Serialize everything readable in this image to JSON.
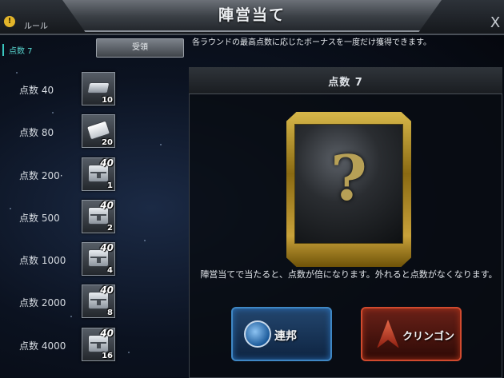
{
  "header": {
    "title": "陣営当て",
    "rule_label": "ルール",
    "rule_icon": "info-icon",
    "close_label": "X"
  },
  "status": {
    "current_score": "点数 7"
  },
  "tabs": {
    "receive_label": "受領"
  },
  "description_top": "各ラウンドの最高点数に応じたボーナスを一度だけ獲得できます。",
  "rewards": [
    {
      "label": "点数 40",
      "icon": "silver-bar-icon",
      "count": "10",
      "badge": ""
    },
    {
      "label": "点数 80",
      "icon": "document-icon",
      "count": "20",
      "badge": ""
    },
    {
      "label": "点数 200·",
      "icon": "chest-icon",
      "count": "1",
      "badge": "40"
    },
    {
      "label": "点数 500",
      "icon": "chest-icon",
      "count": "2",
      "badge": "40"
    },
    {
      "label": "点数 1000",
      "icon": "chest-icon",
      "count": "4",
      "badge": "40"
    },
    {
      "label": "点数 2000",
      "icon": "chest-icon",
      "count": "8",
      "badge": "40"
    },
    {
      "label": "点数 4000",
      "icon": "chest-icon",
      "count": "16",
      "badge": "40"
    }
  ],
  "panel": {
    "score_label": "点数 7",
    "card_symbol": "?",
    "description": "陣営当てで当たると、点数が倍になります。外れると点数がなくなります。"
  },
  "factions": {
    "federation_label": "連邦",
    "klingon_label": "クリンゴン",
    "federation_color": "#3f87c4",
    "klingon_color": "#d04a2e"
  },
  "colors": {
    "accent_gold": "#c9a23a",
    "accent_teal": "#39c6bf"
  }
}
